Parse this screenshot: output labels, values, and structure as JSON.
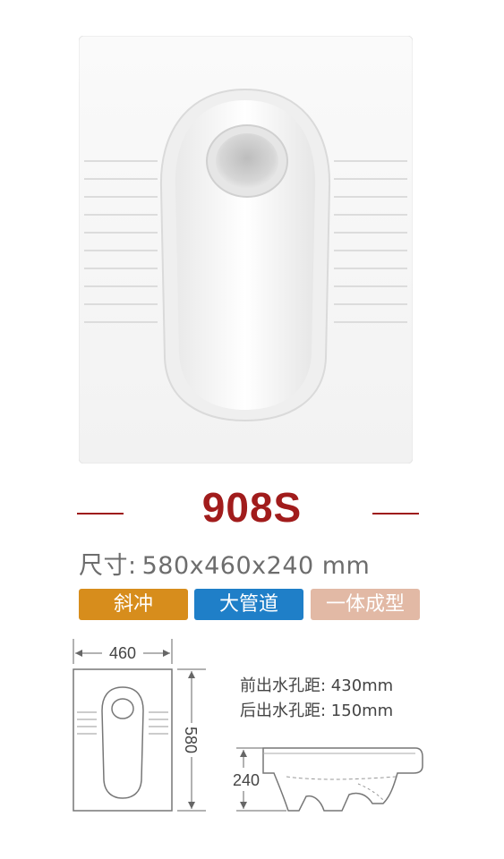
{
  "model": "908S",
  "size_label": "尺寸:",
  "size_value": "580x460x240 mm",
  "tags": [
    {
      "label": "斜冲",
      "color": "#d78d1c"
    },
    {
      "label": "大管道",
      "color": "#1f7fc8"
    },
    {
      "label": "一体成型",
      "color": "#e2b9a5"
    }
  ],
  "accent_color": "#a11c1c",
  "dimensions": {
    "width": "460",
    "length": "580",
    "height": "240"
  },
  "specs": [
    "前出水孔距:  430mm",
    "后出水孔距:  150mm"
  ]
}
